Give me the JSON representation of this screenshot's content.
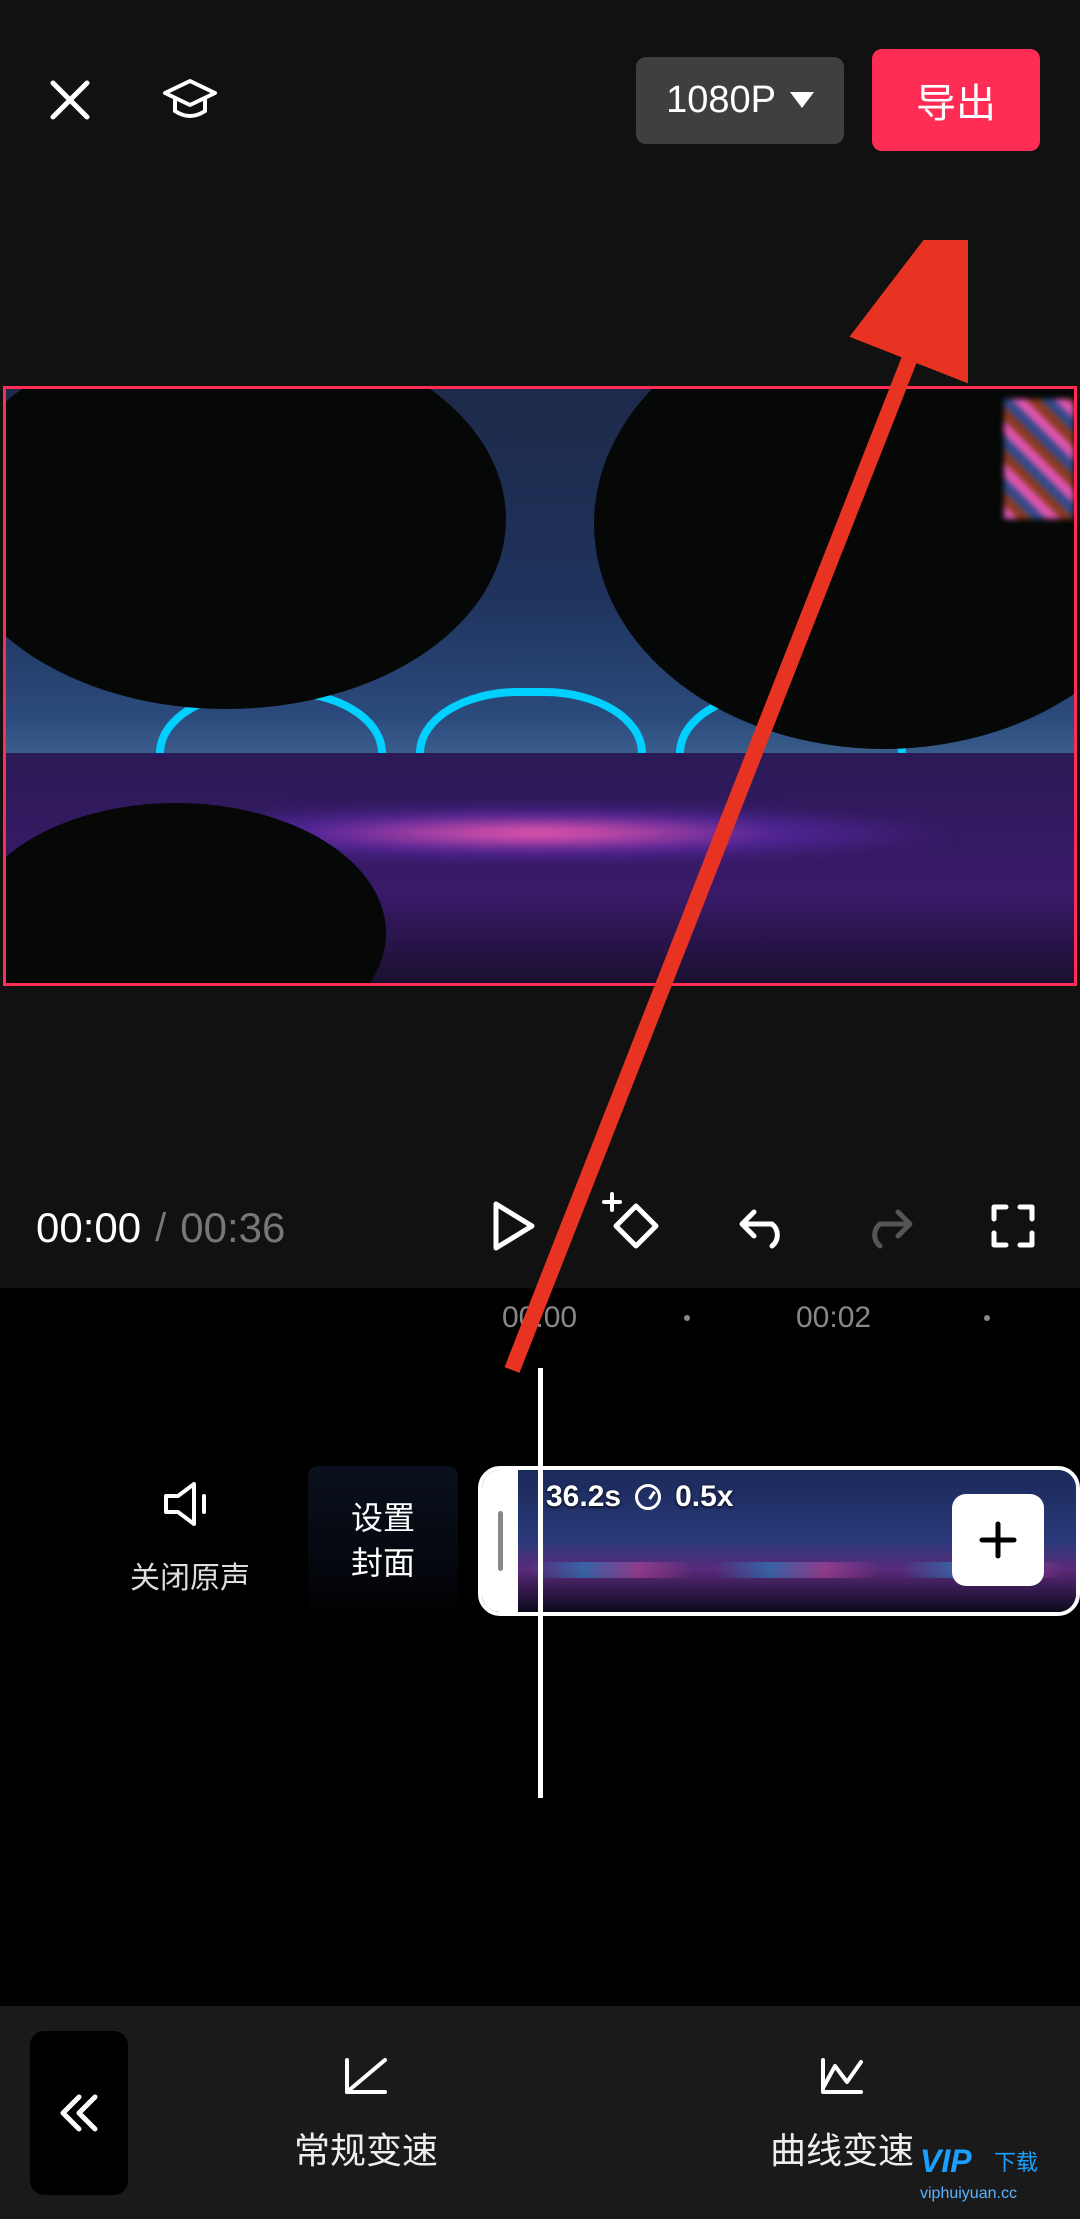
{
  "header": {
    "resolution_label": "1080P",
    "export_label": "导出"
  },
  "playback": {
    "current_time": "00:00",
    "separator": "/",
    "duration": "00:36"
  },
  "ruler": {
    "t0": "00:00",
    "t2": "00:02"
  },
  "audio": {
    "mute_label": "关闭原声"
  },
  "cover": {
    "label": "设置\n封面"
  },
  "clip": {
    "duration_text": "36.2s",
    "speed_text": "0.5x"
  },
  "bottom": {
    "normal_speed_label": "常规变速",
    "curve_speed_label": "曲线变速"
  },
  "watermark": {
    "line1": "VIP 下载",
    "line2": "viphuiyuan.cc"
  },
  "colors": {
    "accent": "#ff2d55"
  }
}
